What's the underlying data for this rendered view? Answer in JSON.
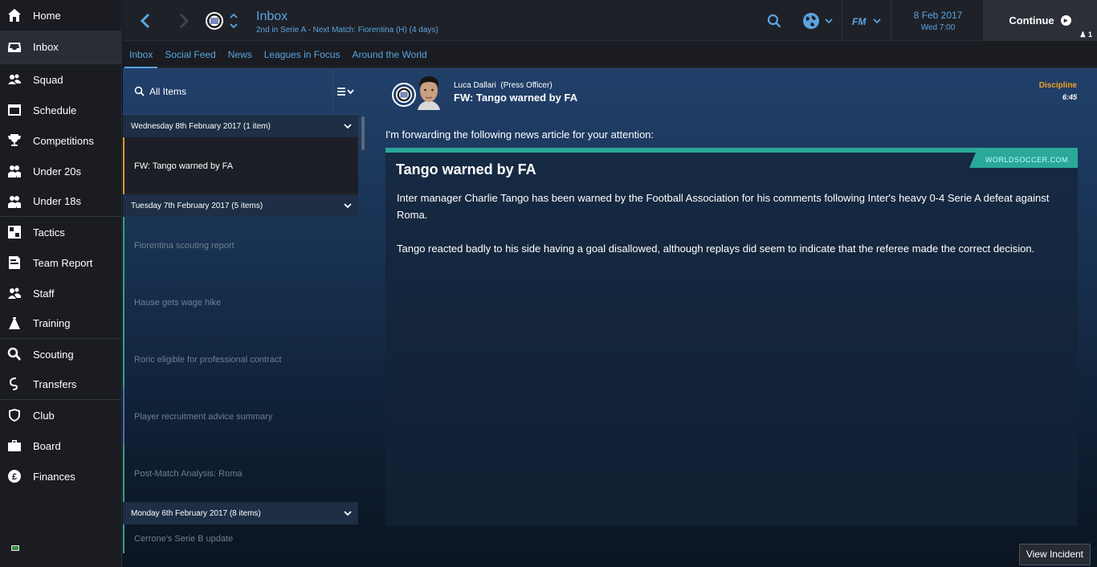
{
  "sidebar": {
    "items": [
      {
        "label": "Home",
        "icon": "home-icon"
      },
      {
        "label": "Inbox",
        "icon": "inbox-icon"
      },
      {
        "label": "Squad",
        "icon": "squad-icon"
      },
      {
        "label": "Schedule",
        "icon": "schedule-icon"
      },
      {
        "label": "Competitions",
        "icon": "trophy-icon"
      },
      {
        "label": "Under 20s",
        "icon": "under20-icon"
      },
      {
        "label": "Under 18s",
        "icon": "under18-icon"
      },
      {
        "label": "Tactics",
        "icon": "tactics-icon"
      },
      {
        "label": "Team Report",
        "icon": "team-report-icon"
      },
      {
        "label": "Staff",
        "icon": "staff-icon"
      },
      {
        "label": "Training",
        "icon": "training-icon"
      },
      {
        "label": "Scouting",
        "icon": "scouting-icon"
      },
      {
        "label": "Transfers",
        "icon": "transfers-icon"
      },
      {
        "label": "Club",
        "icon": "club-icon"
      },
      {
        "label": "Board",
        "icon": "board-icon"
      },
      {
        "label": "Finances",
        "icon": "finances-icon"
      }
    ],
    "active": "Inbox"
  },
  "header": {
    "title": "Inbox",
    "subtitle": "2nd in Serie A - Next Match: Fiorentina (H) (4 days)",
    "date": "8 Feb 2017",
    "day_time": "Wed 7:00",
    "continue_label": "Continue",
    "user_count": "1"
  },
  "tabs": [
    "Inbox",
    "Social Feed",
    "News",
    "Leagues in Focus",
    "Around the World"
  ],
  "list": {
    "filter_label": "All Items",
    "groups": [
      {
        "title": "Wednesday 8th February 2017 (1 item)",
        "items": [
          "FW: Tango warned by FA"
        ]
      },
      {
        "title": "Tuesday 7th February 2017 (5 items)",
        "items": [
          "Fiorentina scouting report",
          "Hause gets wage hike",
          "Roric eligible for professional contract",
          "Player recruitment advice summary",
          "Post-Match Analysis: Roma"
        ]
      },
      {
        "title": "Monday 6th February 2017 (8 items)",
        "items": [
          "Cerrone's Serie B update"
        ]
      }
    ]
  },
  "message": {
    "sender": "Luca Dallari",
    "sender_role": "(Press Officer)",
    "subject": "FW: Tango warned by FA",
    "category": "Discipline",
    "time": "6:45",
    "intro": "I'm forwarding the following news article for your attention:",
    "source": "WORLDSOCCER.COM",
    "article_title": "Tango warned by FA",
    "paragraphs": [
      "Inter manager Charlie Tango has been warned by the Football Association for his comments following Inter's heavy 0-4 Serie A defeat against Roma.",
      "Tango reacted badly to his side having a goal disallowed, although replays did seem to indicate that the referee made the correct decision."
    ],
    "action_label": "View Incident"
  },
  "colors": {
    "accent": "#5aa5e0",
    "discipline": "#f0a020",
    "teal": "#2aa89a",
    "selected_marker": "#e0982a"
  }
}
